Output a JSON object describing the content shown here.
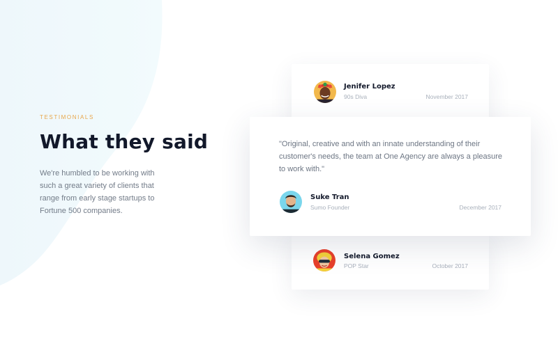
{
  "section": {
    "eyebrow": "TESTIMONIALS",
    "title": "What they said",
    "description": "We're humbled to be working with such a great variety of clients that range from early stage startups to Fortune 500 companies."
  },
  "testimonials": [
    {
      "name": "Jenifer Lopez",
      "role": "90s Diva",
      "date": "November 2017",
      "avatar_icon": "avatar-jenifer-lopez",
      "avatar_bg": "#f2b84b"
    },
    {
      "name": "Suke Tran",
      "role": "Sumo Founder",
      "date": "December 2017",
      "quote": "\"Original, creative and with an innate understanding of their customer's needs, the team at One Agency are always a pleasure to work with.\"",
      "avatar_icon": "avatar-suke-tran",
      "avatar_bg": "#7ad6ec"
    },
    {
      "name": "Selena Gomez",
      "role": "POP Star",
      "date": "October 2017",
      "avatar_icon": "avatar-selena-gomez",
      "avatar_bg": "#e8402a"
    }
  ],
  "colors": {
    "accent": "#e8a64a",
    "heading": "#12182a",
    "body": "#727b88",
    "muted": "#a8b0bb",
    "blob": "#eef8fc"
  }
}
